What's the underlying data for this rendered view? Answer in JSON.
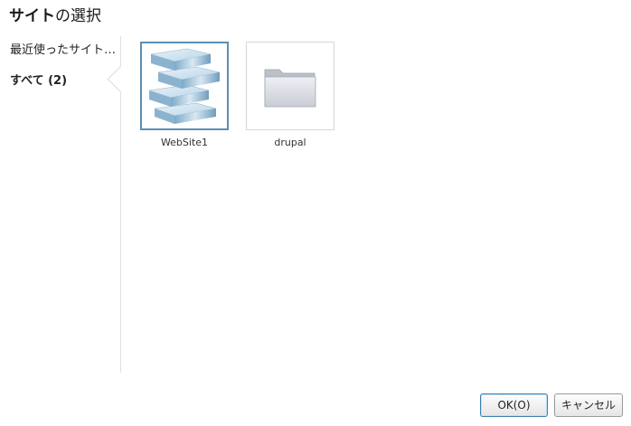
{
  "dialog": {
    "title_bold": "サイト",
    "title_rest": "の選択"
  },
  "sidebar": {
    "items": [
      {
        "label": "最近使ったサイト…"
      },
      {
        "label": "すべて (2)"
      }
    ]
  },
  "sites": [
    {
      "name": "WebSite1",
      "icon": "website-stack-icon",
      "selected": true
    },
    {
      "name": "drupal",
      "icon": "folder-icon",
      "selected": false
    }
  ],
  "buttons": {
    "ok_label": "OK(O)",
    "cancel_label": "キャンセル"
  },
  "colors": {
    "selected_border": "#5b8fb0",
    "ok_border": "#3c7fb1"
  }
}
